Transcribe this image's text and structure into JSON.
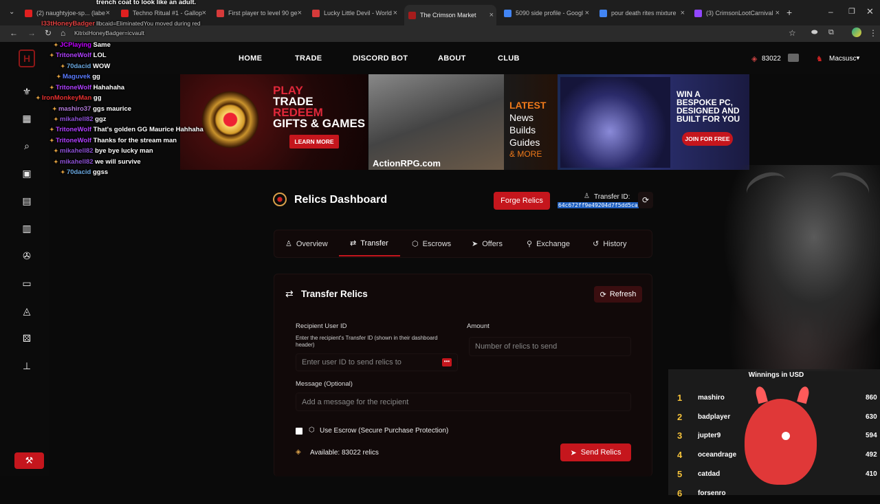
{
  "browser": {
    "tabs": [
      {
        "title": "(2) naughtyjoe-sp... (labe",
        "color": "#e02020"
      },
      {
        "title": "Techno Ritual #1 - Gallop",
        "color": "#e02020"
      },
      {
        "title": "First player to level 90 ge",
        "color": "#d63a3a"
      },
      {
        "title": "Lucky Little Devil - World",
        "color": "#d63a3a"
      },
      {
        "title": "The Crimson Market",
        "color": "#a51c1c"
      },
      {
        "title": "5090 side profile - Googl",
        "color": "#4285f4"
      },
      {
        "title": "pour death rites mixture",
        "color": "#4285f4"
      },
      {
        "title": "(3) CrimsonLootCarnival",
        "color": "#9146ff"
      }
    ],
    "new_tab": "+",
    "close": "×"
  },
  "site": {
    "nav": [
      "HOME",
      "TRADE",
      "DISCORD BOT",
      "ABOUT",
      "CLUB"
    ],
    "balance": "83022",
    "user": "Macsusc"
  },
  "banners": {
    "b1_line1": "PLAY",
    "b1_line2": "TRADE",
    "b1_line3": "REDEEM",
    "b1_line4": "GIFTS & GAMES",
    "b1_button": "LEARN MORE",
    "b2_line1": "LATEST",
    "b2_line2": "News",
    "b2_line3": "Builds",
    "b2_line4": "Guides",
    "b2_line5": "& MORE",
    "b2_site": "ActionRPG.com",
    "b3_line1": "WIN A",
    "b3_line2": "BESPOKE PC,",
    "b3_line3": "DESIGNED AND",
    "b3_line4": "BUILT FOR YOU",
    "b3_button": "JOIN FOR FREE"
  },
  "chat": {
    "overlay_top": "trench coat to look like an adult.",
    "overlay_top2": "l33tHoneyBadger",
    "overlay_top3": "llbcaid=EliminatedYou moved during red",
    "overlay_top4": "KitrixiHoneyBadger=icvault",
    "messages": [
      {
        "user": "JCPlaying",
        "text": "Same",
        "color": "#c000ff"
      },
      {
        "user": "TritoneWolf",
        "text": "LOL",
        "color": "#b040ff"
      },
      {
        "user": "70dacid",
        "text": "WOW",
        "color": "#6aa8e0"
      },
      {
        "user": "Maguvek",
        "text": "gg",
        "color": "#5a7bff"
      },
      {
        "user": "TritoneWolf",
        "text": "Hahahaha",
        "color": "#b040ff"
      },
      {
        "user": "IronMonkeyMan",
        "text": "gg",
        "color": "#e83030"
      },
      {
        "user": "mashiro37",
        "text": "ggs maurice",
        "color": "#b07ad8"
      },
      {
        "user": "mikahell82",
        "text": "ggz",
        "color": "#8a4fd1"
      },
      {
        "user": "TritoneWolf",
        "text": "That's golden GG Maurice Hahhaha",
        "color": "#b040ff"
      },
      {
        "user": "TritoneWolf",
        "text": "Thanks for the stream man",
        "color": "#b040ff"
      },
      {
        "user": "mikahell82",
        "text": "bye bye lucky man",
        "color": "#8a4fd1"
      },
      {
        "user": "mikahell82",
        "text": "we will survive",
        "color": "#8a4fd1"
      },
      {
        "user": "70dacid",
        "text": "ggss",
        "color": "#6aa8e0"
      }
    ]
  },
  "dashboard": {
    "title": "Relics Dashboard",
    "forge_button": "Forge Relics",
    "transfer_label": "Transfer ID:",
    "transfer_id": "64c672ff9e49204d7f5dd5ca",
    "tabs": [
      "Overview",
      "Transfer",
      "Escrows",
      "Offers",
      "Exchange",
      "History"
    ],
    "active_tab": "Transfer",
    "section_title": "Transfer Relics",
    "refresh": "Refresh",
    "recipient_label": "Recipient User ID",
    "recipient_help": "Enter the recipient's Transfer ID (shown in their dashboard header)",
    "recipient_placeholder": "Enter user ID to send relics to",
    "amount_label": "Amount",
    "amount_placeholder": "Number of relics to send",
    "message_label": "Message (Optional)",
    "message_placeholder": "Add a message for the recipient",
    "escrow_label": "Use Escrow (Secure Purchase Protection)",
    "available": "Available: 83022 relics",
    "send_button": "Send Relics"
  },
  "leaderboard": {
    "title": "Winnings in USD",
    "rows": [
      {
        "rank": "1",
        "name": "mashiro",
        "value": "860"
      },
      {
        "rank": "2",
        "name": "badplayer",
        "value": "630"
      },
      {
        "rank": "3",
        "name": "jupter9",
        "value": "594"
      },
      {
        "rank": "4",
        "name": "oceandrage",
        "value": "492"
      },
      {
        "rank": "5",
        "name": "catdad",
        "value": "410"
      },
      {
        "rank": "6",
        "name": "forsenro",
        "value": ""
      }
    ]
  },
  "colors": {
    "accent": "#c5161d",
    "bg": "#0a0a0a"
  }
}
